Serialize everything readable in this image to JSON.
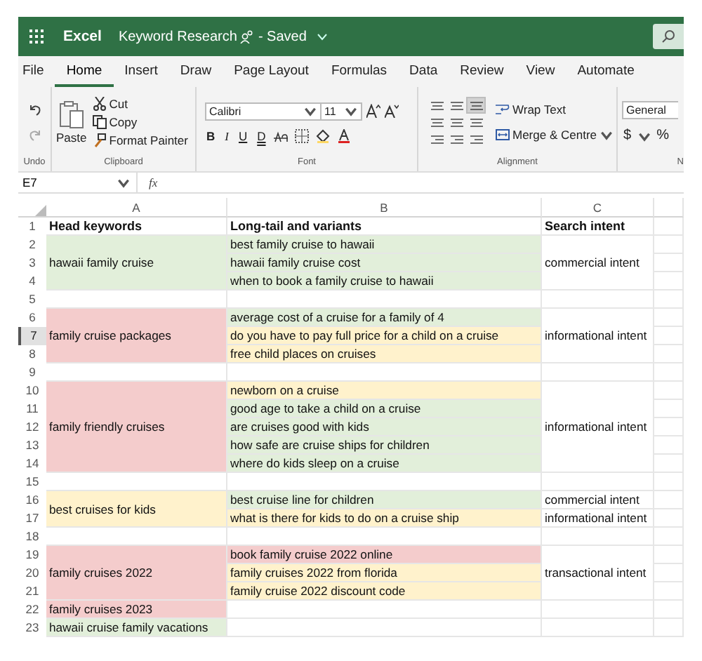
{
  "title_bar": {
    "app": "Excel",
    "document": "Keyword Research",
    "status": "- Saved"
  },
  "tabs": [
    {
      "label": "File",
      "selected": false
    },
    {
      "label": "Home",
      "selected": true
    },
    {
      "label": "Insert",
      "selected": false
    },
    {
      "label": "Draw",
      "selected": false
    },
    {
      "label": "Page Layout",
      "selected": false
    },
    {
      "label": "Formulas",
      "selected": false
    },
    {
      "label": "Data",
      "selected": false
    },
    {
      "label": "Review",
      "selected": false
    },
    {
      "label": "View",
      "selected": false
    },
    {
      "label": "Automate",
      "selected": false
    }
  ],
  "ribbon": {
    "undo": {
      "label": "Undo"
    },
    "clipboard": {
      "paste": "Paste",
      "cut": "Cut",
      "copy": "Copy",
      "format_painter": "Format Painter",
      "label": "Clipboard"
    },
    "font": {
      "family": "Calibri",
      "size": "11",
      "label": "Font",
      "bold": "B",
      "italic": "I",
      "underline": "U",
      "double_underline": "D"
    },
    "alignment": {
      "buttons": [
        {
          "selected": false
        },
        {
          "selected": false
        },
        {
          "selected": true
        },
        {
          "selected": false
        },
        {
          "selected": false
        },
        {
          "selected": false
        },
        {
          "selected": false
        },
        {
          "selected": false
        },
        {
          "selected": false
        }
      ],
      "wrap_text": "Wrap Text",
      "merge": "Merge & Centre",
      "label": "Alignment"
    },
    "number": {
      "format": "General",
      "currency": "$",
      "percent": "%",
      "label": "N"
    }
  },
  "formula_bar": {
    "cell": "E7",
    "fx": "fx"
  },
  "sheet": {
    "column_headers": [
      "A",
      "B",
      "C"
    ],
    "rows": [
      {
        "label": "1",
        "selected": false,
        "cells": [
          {
            "kind": "header",
            "text": "Head keywords"
          },
          {
            "kind": "header",
            "text": "Long-tail and variants"
          },
          {
            "kind": "header",
            "text": "Search intent"
          }
        ]
      },
      {
        "label": "2",
        "selected": false,
        "cells": [
          {
            "kind": "merged_above"
          },
          {
            "kind": "cell",
            "text": "best family cruise to hawaii",
            "color": "#e2efda"
          },
          {
            "kind": "merged_above"
          }
        ]
      },
      {
        "label": "3",
        "selected": false,
        "cells": [
          {
            "kind": "cell",
            "text": "hawaii family cruise",
            "color": "#e2efda"
          },
          {
            "kind": "cell",
            "text": "hawaii family cruise cost",
            "color": "#e2efda"
          },
          {
            "kind": "cell",
            "text": "commercial intent"
          }
        ]
      },
      {
        "label": "4",
        "selected": false,
        "cells": [
          {
            "kind": "merged"
          },
          {
            "kind": "cell",
            "text": "when to book a family cruise to hawaii",
            "color": "#e2efda"
          },
          {
            "kind": "merged"
          }
        ]
      },
      {
        "label": "5",
        "selected": false,
        "cells": [
          {
            "kind": "empty"
          },
          {
            "kind": "empty"
          },
          {
            "kind": "empty"
          }
        ]
      },
      {
        "label": "6",
        "selected": false,
        "cells": [
          {
            "kind": "merged_above"
          },
          {
            "kind": "cell",
            "text": "average cost of a cruise for a family of 4",
            "color": "#e2efda"
          },
          {
            "kind": "merged_above"
          }
        ]
      },
      {
        "label": "7",
        "selected": true,
        "cells": [
          {
            "kind": "cell",
            "text": "family cruise packages",
            "color": "#f4cccc"
          },
          {
            "kind": "cell",
            "text": "do you have to pay full price for a child on a cruise",
            "color": "#fff2cc"
          },
          {
            "kind": "cell",
            "text": "informational intent"
          }
        ]
      },
      {
        "label": "8",
        "selected": false,
        "cells": [
          {
            "kind": "merged"
          },
          {
            "kind": "cell",
            "text": "free child places on cruises",
            "color": "#fff2cc"
          },
          {
            "kind": "merged"
          }
        ]
      },
      {
        "label": "9",
        "selected": false,
        "cells": [
          {
            "kind": "empty"
          },
          {
            "kind": "empty"
          },
          {
            "kind": "empty"
          }
        ]
      },
      {
        "label": "10",
        "selected": false,
        "cells": [
          {
            "kind": "merged_above"
          },
          {
            "kind": "cell",
            "text": "newborn on a cruise",
            "color": "#fff2cc"
          },
          {
            "kind": "merged_above"
          }
        ]
      },
      {
        "label": "11",
        "selected": false,
        "cells": [
          {
            "kind": "merged_above"
          },
          {
            "kind": "cell",
            "text": "good age to take a child on a cruise",
            "color": "#e2efda"
          },
          {
            "kind": "merged_above"
          }
        ]
      },
      {
        "label": "12",
        "selected": false,
        "cells": [
          {
            "kind": "cell",
            "text": "family friendly cruises",
            "color": "#f4cccc"
          },
          {
            "kind": "cell",
            "text": "are cruises good with kids",
            "color": "#e2efda"
          },
          {
            "kind": "cell",
            "text": "informational intent"
          }
        ]
      },
      {
        "label": "13",
        "selected": false,
        "cells": [
          {
            "kind": "merged"
          },
          {
            "kind": "cell",
            "text": "how safe are cruise ships for children",
            "color": "#e2efda"
          },
          {
            "kind": "merged"
          }
        ]
      },
      {
        "label": "14",
        "selected": false,
        "cells": [
          {
            "kind": "merged"
          },
          {
            "kind": "cell",
            "text": "where do kids sleep on a cruise",
            "color": "#e2efda"
          },
          {
            "kind": "merged"
          }
        ]
      },
      {
        "label": "15",
        "selected": false,
        "cells": [
          {
            "kind": "empty"
          },
          {
            "kind": "empty"
          },
          {
            "kind": "empty"
          }
        ]
      },
      {
        "label": "16",
        "selected": false,
        "cells": [
          {
            "kind": "cell",
            "text": "best cruises for kids",
            "color": "#fff2cc"
          },
          {
            "kind": "cell",
            "text": "best cruise line for children",
            "color": "#e2efda"
          },
          {
            "kind": "cell",
            "text": "commercial intent"
          }
        ]
      },
      {
        "label": "17",
        "selected": false,
        "cells": [
          {
            "kind": "merged"
          },
          {
            "kind": "cell",
            "text": "what is there for kids to do on a cruise ship",
            "color": "#fff2cc"
          },
          {
            "kind": "cell",
            "text": "informational intent"
          }
        ]
      },
      {
        "label": "18",
        "selected": false,
        "cells": [
          {
            "kind": "empty"
          },
          {
            "kind": "empty"
          },
          {
            "kind": "empty"
          }
        ]
      },
      {
        "label": "19",
        "selected": false,
        "cells": [
          {
            "kind": "merged_above"
          },
          {
            "kind": "cell",
            "text": "book family cruise 2022 online",
            "color": "#f4cccc"
          },
          {
            "kind": "merged_above"
          }
        ]
      },
      {
        "label": "20",
        "selected": false,
        "cells": [
          {
            "kind": "cell",
            "text": "family cruises 2022",
            "color": "#f4cccc"
          },
          {
            "kind": "cell",
            "text": "family cruises 2022 from florida",
            "color": "#fff2cc"
          },
          {
            "kind": "cell",
            "text": "transactional intent"
          }
        ]
      },
      {
        "label": "21",
        "selected": false,
        "cells": [
          {
            "kind": "merged"
          },
          {
            "kind": "cell",
            "text": "family cruise 2022 discount code",
            "color": "#fff2cc"
          },
          {
            "kind": "merged"
          }
        ]
      },
      {
        "label": "22",
        "selected": false,
        "cells": [
          {
            "kind": "cell",
            "text": "family cruises 2023",
            "color": "#f4cccc"
          },
          {
            "kind": "empty"
          },
          {
            "kind": "empty"
          }
        ]
      },
      {
        "label": "23",
        "selected": false,
        "cells": [
          {
            "kind": "cell",
            "text": "hawaii cruise family vacations",
            "color": "#e2efda"
          },
          {
            "kind": "empty"
          },
          {
            "kind": "empty"
          }
        ]
      }
    ]
  }
}
